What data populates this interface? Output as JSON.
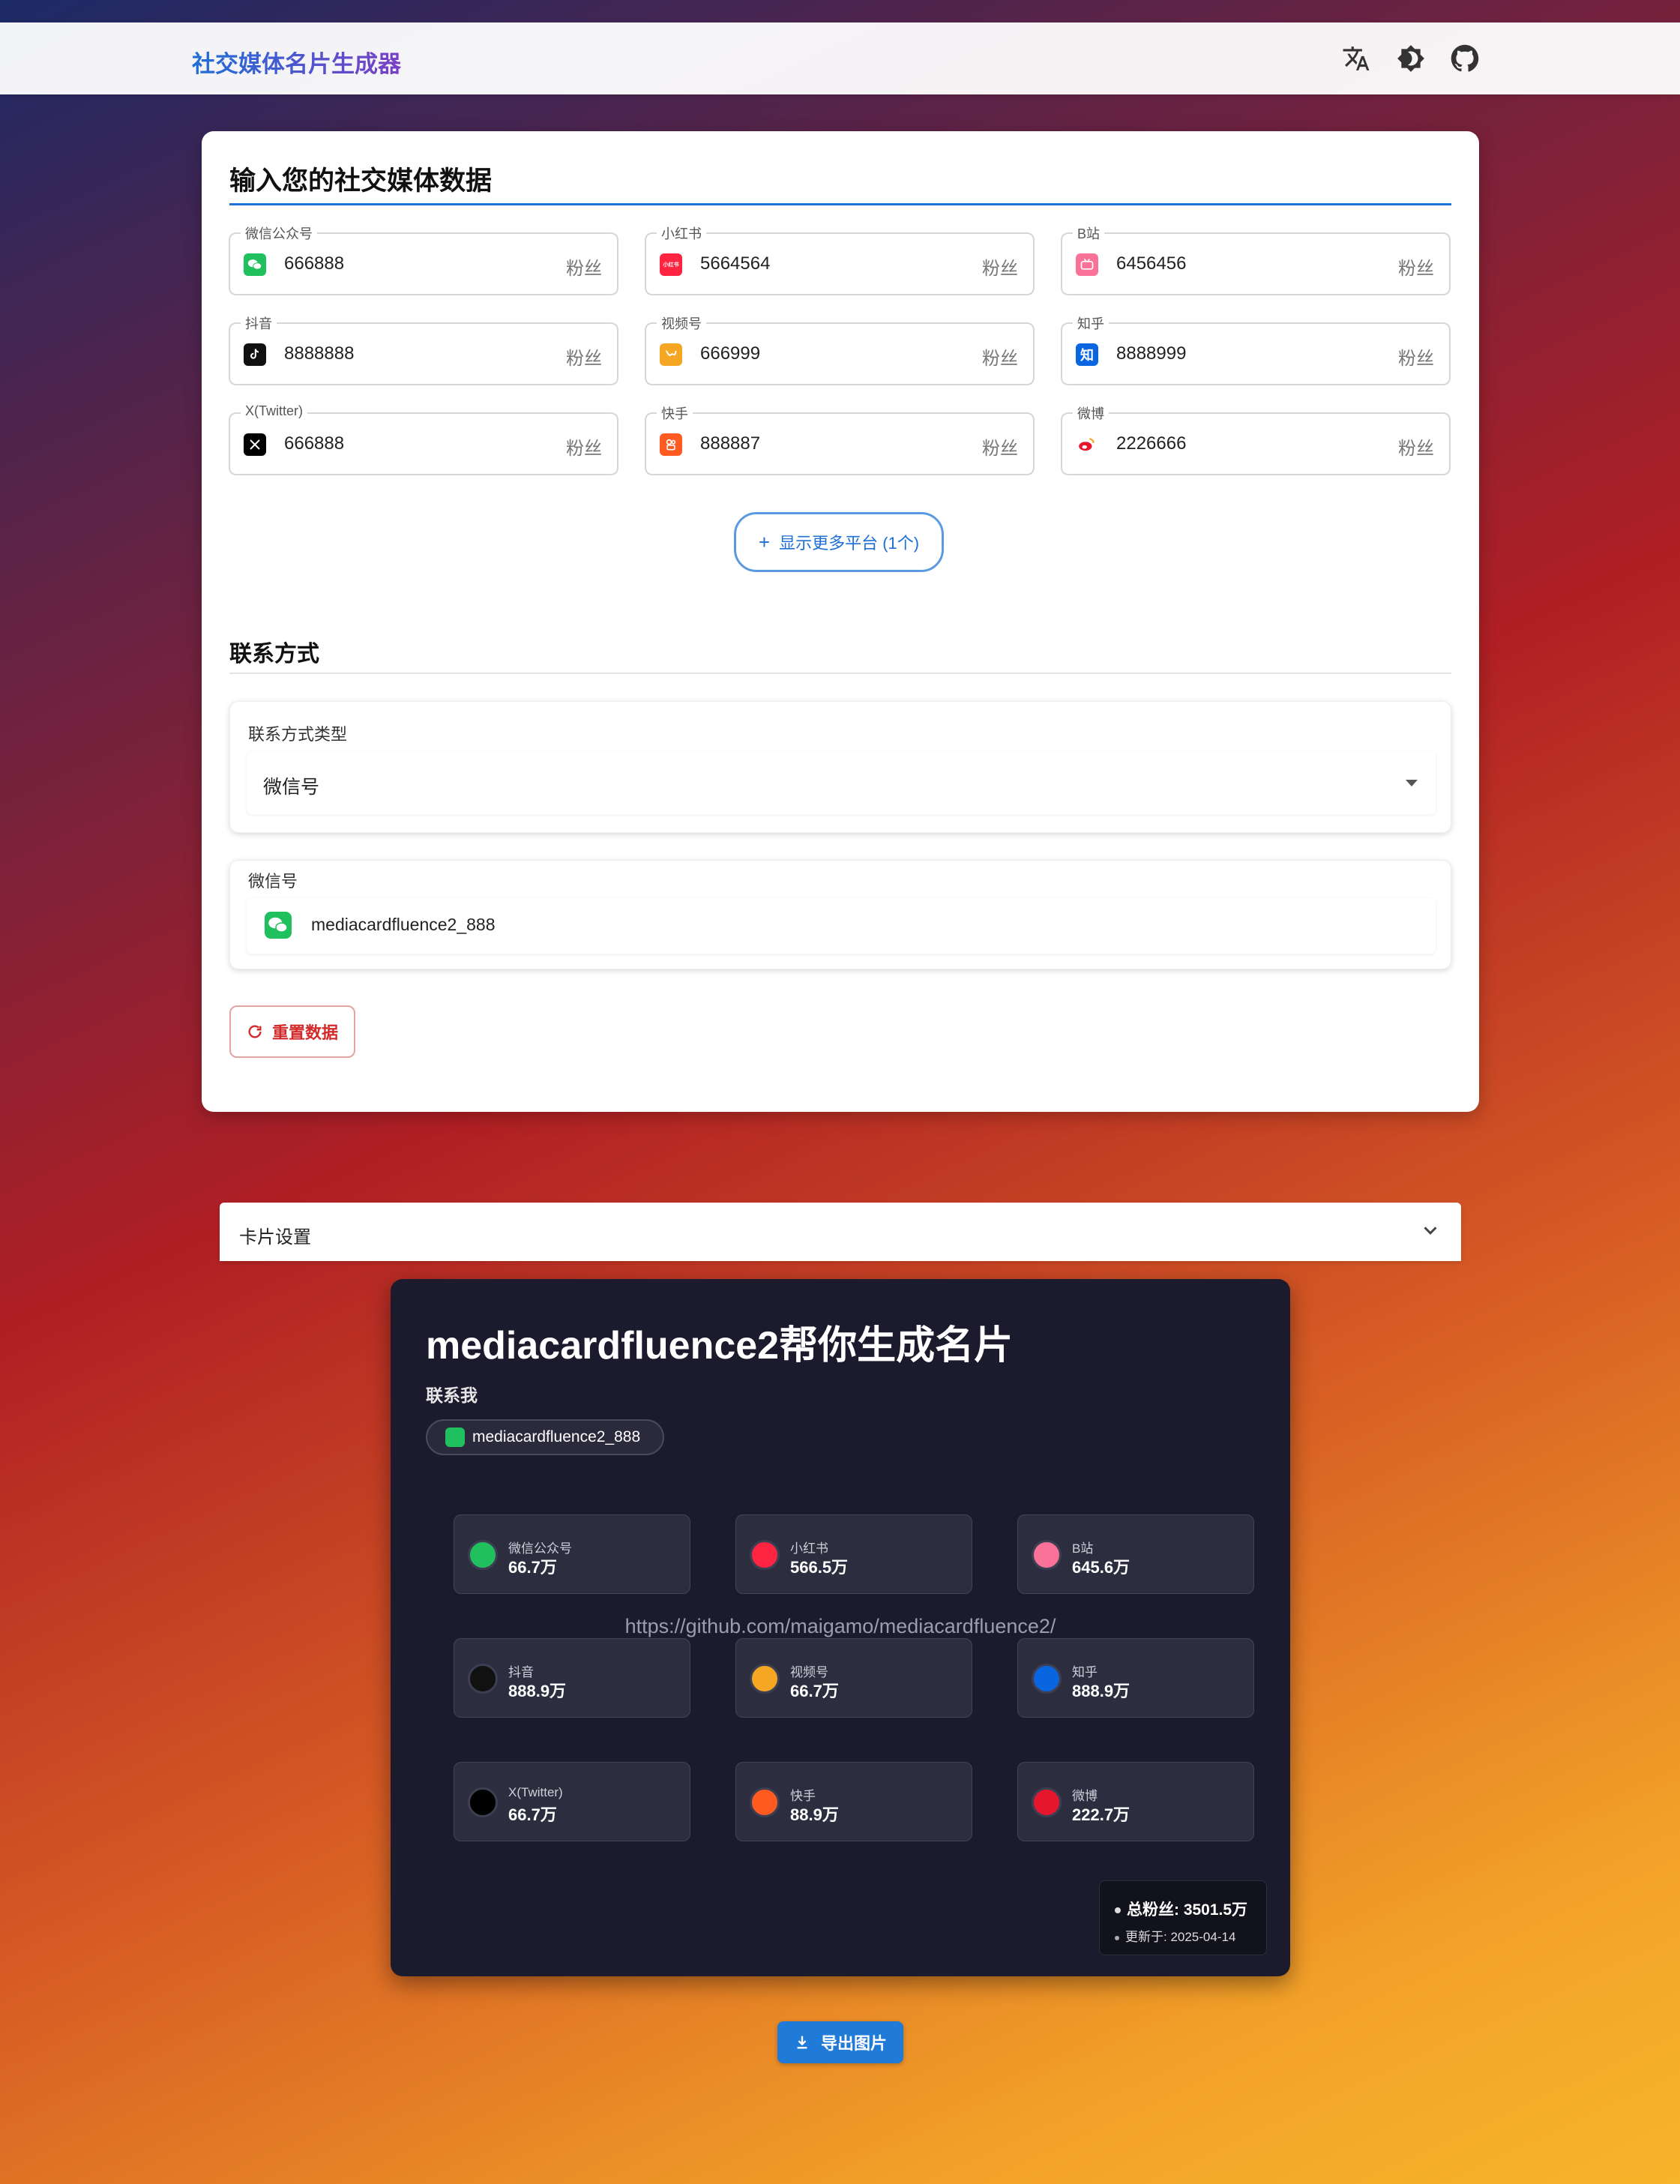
{
  "header": {
    "brand": "社交媒体名片生成器"
  },
  "input_section": {
    "title": "输入您的社交媒体数据",
    "suffix": "粉丝",
    "platforms": [
      {
        "label": "微信公众号",
        "value": "666888",
        "color": "#21c05e",
        "icon": "wechat-icon"
      },
      {
        "label": "小红书",
        "value": "5664564",
        "color": "#ff2442",
        "icon": "xiaohongshu-icon"
      },
      {
        "label": "B站",
        "value": "6456456",
        "color": "#fb7299",
        "icon": "bilibili-icon"
      },
      {
        "label": "抖音",
        "value": "8888888",
        "color": "#111111",
        "icon": "douyin-icon"
      },
      {
        "label": "视频号",
        "value": "666999",
        "color": "#f5a623",
        "icon": "channels-icon"
      },
      {
        "label": "知乎",
        "value": "8888999",
        "color": "#0a66e0",
        "icon": "zhihu-icon"
      },
      {
        "label": "X(Twitter)",
        "value": "666888",
        "color": "#000000",
        "icon": "x-icon"
      },
      {
        "label": "快手",
        "value": "888887",
        "color": "#ff5a1f",
        "icon": "kuaishou-icon"
      },
      {
        "label": "微博",
        "value": "2226666",
        "color": "#e6162d",
        "icon": "weibo-icon"
      }
    ],
    "more_button": "显示更多平台 (1个)",
    "icon_text": {
      "zhihu": "知",
      "xhs": "小红书"
    }
  },
  "contact": {
    "title": "联系方式",
    "type_label": "联系方式类型",
    "type_value": "微信号",
    "id_label": "微信号",
    "id_value": "mediacardfluence2_888",
    "reset_button": "重置数据"
  },
  "settings": {
    "label": "卡片设置"
  },
  "card": {
    "title": "mediacardfluence2帮你生成名片",
    "contact_heading": "联系我",
    "contact_value": "mediacardfluence2_888",
    "watermark": "https://github.com/maigamo/mediacardfluence2/",
    "stats": [
      {
        "name": "微信公众号",
        "value": "66.7万",
        "color": "#21c05e"
      },
      {
        "name": "小红书",
        "value": "566.5万",
        "color": "#ff2442"
      },
      {
        "name": "B站",
        "value": "645.6万",
        "color": "#fb7299"
      },
      {
        "name": "抖音",
        "value": "888.9万",
        "color": "#111111"
      },
      {
        "name": "视频号",
        "value": "66.7万",
        "color": "#f5a623"
      },
      {
        "name": "知乎",
        "value": "888.9万",
        "color": "#0a66e0"
      },
      {
        "name": "X(Twitter)",
        "value": "66.7万",
        "color": "#000000"
      },
      {
        "name": "快手",
        "value": "88.9万",
        "color": "#ff5a1f"
      },
      {
        "name": "微博",
        "value": "222.7万",
        "color": "#e6162d"
      }
    ],
    "total": "总粉丝: 3501.5万",
    "updated": "更新于: 2025-04-14"
  },
  "export_button": "导出图片"
}
